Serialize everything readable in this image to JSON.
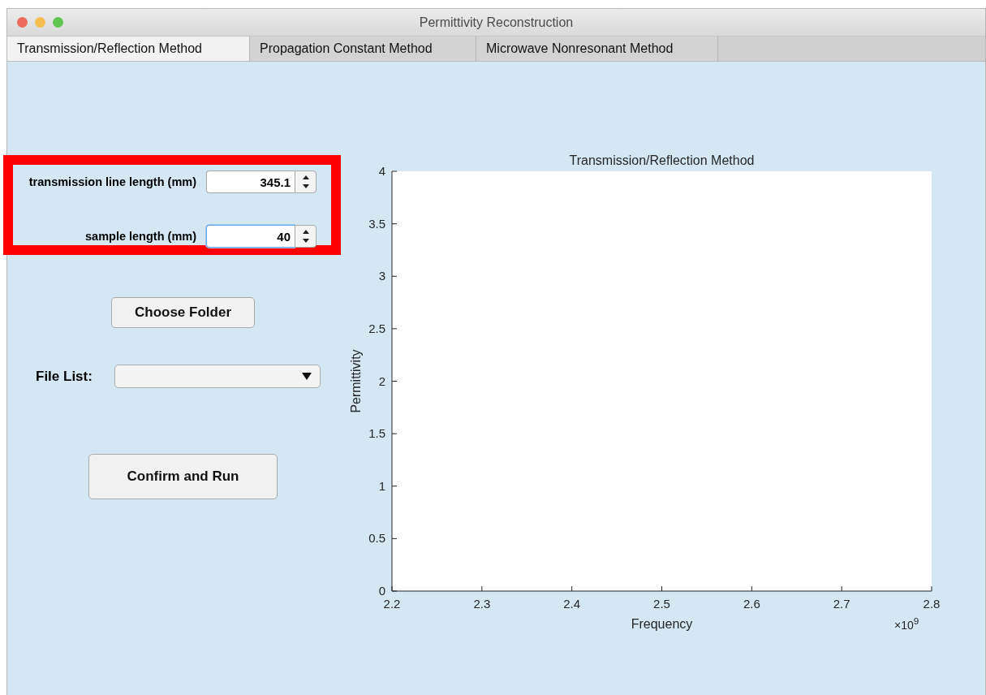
{
  "window": {
    "title": "Permittivity Reconstruction"
  },
  "tabs": [
    {
      "label": "Transmission/Reflection Method",
      "selected": true
    },
    {
      "label": "Propagation Constant Method",
      "selected": false
    },
    {
      "label": "Microwave Nonresonant Method",
      "selected": false
    }
  ],
  "parameters": {
    "highlighted": true,
    "fields": [
      {
        "label": "transmission line length (mm)",
        "value": "345.1",
        "focused": false
      },
      {
        "label": "sample length (mm)",
        "value": "40",
        "focused": true
      }
    ]
  },
  "choose_button": "Choose Folder",
  "file_list": {
    "label": "File List:"
  },
  "run_button": "Confirm and Run",
  "plot": {
    "exponent": "×10$^{9}$",
    "chart_data": {
      "type": "line",
      "title": "Transmission/Reflection Method",
      "xlabel": "Frequency",
      "ylabel": "Permittivity",
      "xlim": [
        2.2,
        2.8
      ],
      "ylim": [
        0,
        4
      ],
      "xticks": [
        2.2,
        2.3,
        2.4,
        2.5,
        2.6,
        2.7,
        2.8
      ],
      "yticks": [
        0,
        0.5,
        1,
        1.5,
        2,
        2.5,
        3,
        3.5,
        4
      ]
    }
  }
}
